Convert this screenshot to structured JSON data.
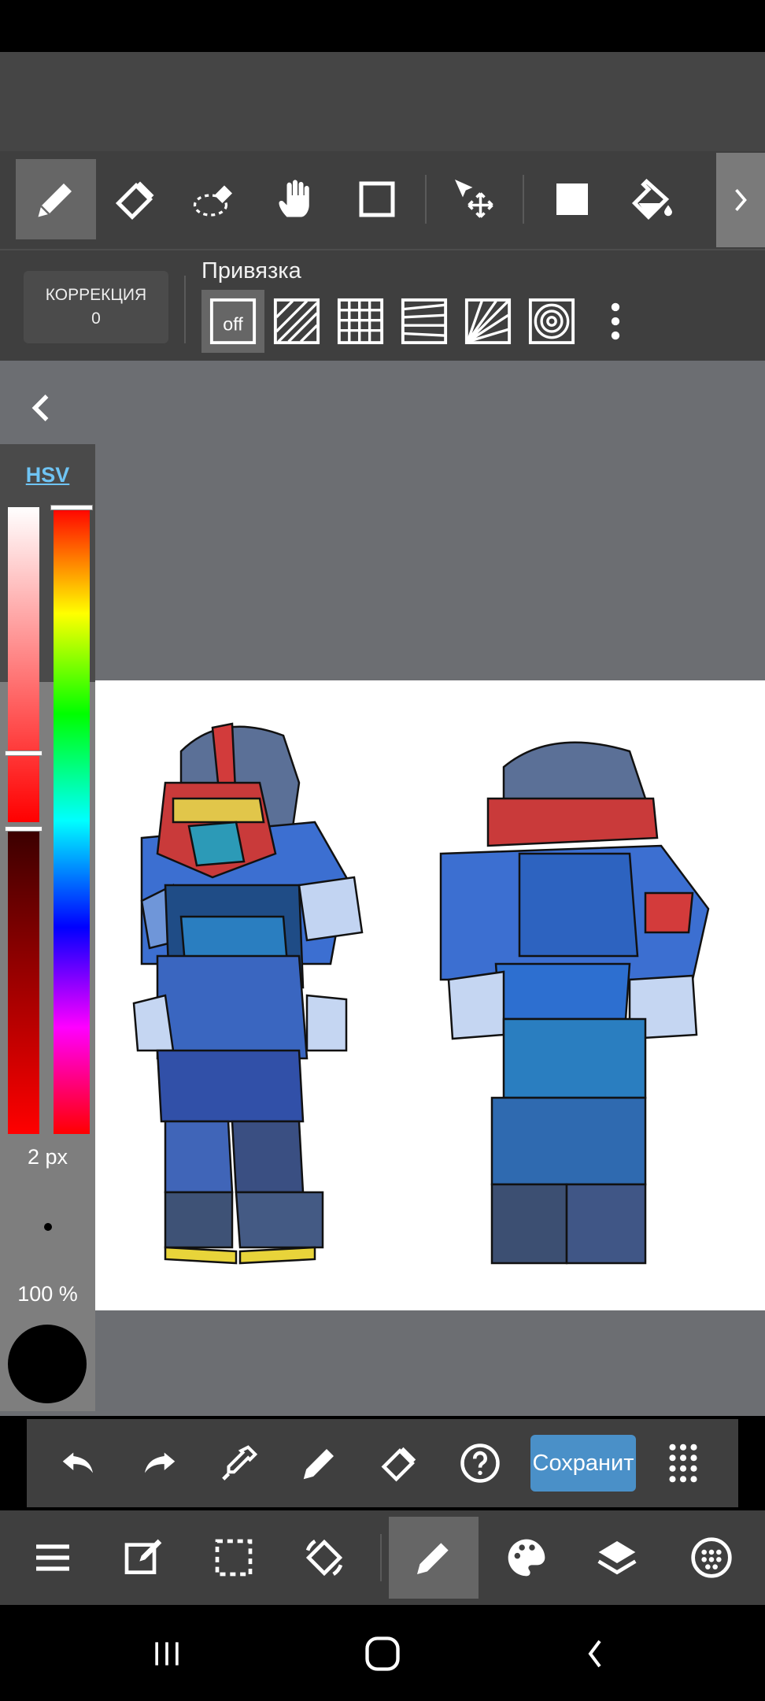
{
  "app": {
    "colors": {
      "accent": "#4a90c8",
      "toolbar_bg": "#3f3f3f",
      "canvas_bg": "#6c6e72",
      "hsv_link": "#6fc4f4",
      "current_color": "#000000"
    }
  },
  "toolbar": {
    "tools": [
      {
        "name": "pen-tool",
        "icon": "pen-icon",
        "active": true
      },
      {
        "name": "eraser-tool",
        "icon": "eraser-icon",
        "active": false
      },
      {
        "name": "blur-eraser-tool",
        "icon": "lasso-eraser-icon",
        "active": false
      },
      {
        "name": "hand-tool",
        "icon": "hand-icon",
        "active": false
      },
      {
        "name": "rectangle-tool",
        "icon": "rectangle-icon",
        "active": false
      },
      {
        "name": "move-tool",
        "icon": "move-icon",
        "active": false
      },
      {
        "name": "fill-rect-tool",
        "icon": "filled-square-icon",
        "active": false
      },
      {
        "name": "bucket-tool",
        "icon": "paint-bucket-icon",
        "active": false
      }
    ]
  },
  "snap": {
    "correction_label": "КОРРЕКЦИЯ",
    "correction_value": "0",
    "title": "Привязка",
    "off_label": "off",
    "options": [
      "off-icon",
      "parallel-lines-icon",
      "grid-icon",
      "perspective-lines-icon",
      "radial-lines-icon",
      "concentric-circles-icon"
    ]
  },
  "color_panel": {
    "mode_label": "HSV",
    "brush_size": "2 px",
    "opacity": "100 %",
    "saturation_level": 0.78,
    "value_level": 0.0,
    "hue_level": 0.0
  },
  "action_bar": {
    "save_label": "Сохранит",
    "items": [
      "undo-icon",
      "redo-icon",
      "eyedropper-icon",
      "pen-icon",
      "eraser-icon",
      "help-icon",
      "save-button",
      "grid-dots-icon"
    ]
  },
  "bottom_bar": {
    "tabs": [
      {
        "name": "menu",
        "icon": "hamburger-icon",
        "active": false
      },
      {
        "name": "edit",
        "icon": "edit-icon",
        "active": false
      },
      {
        "name": "selection",
        "icon": "selection-icon",
        "active": false
      },
      {
        "name": "transform",
        "icon": "rotate-icon",
        "active": false
      },
      {
        "name": "brush",
        "icon": "pen-icon",
        "active": true
      },
      {
        "name": "color",
        "icon": "palette-icon",
        "active": false
      },
      {
        "name": "layers",
        "icon": "layers-icon",
        "active": false
      },
      {
        "name": "material",
        "icon": "material-icon",
        "active": false
      }
    ]
  },
  "nav": {
    "items": [
      "recent-apps-icon",
      "home-icon",
      "back-icon"
    ]
  }
}
